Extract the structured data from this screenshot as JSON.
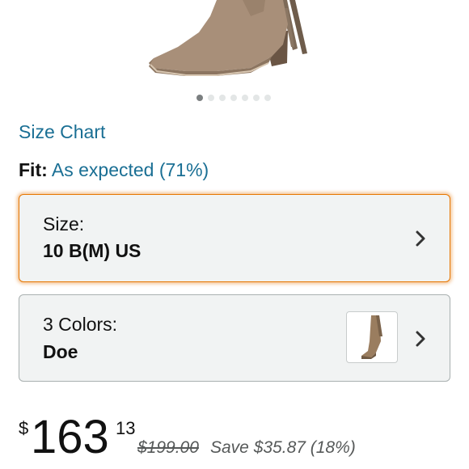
{
  "carousel": {
    "count": 7,
    "active_index": 0
  },
  "size_chart": {
    "label": "Size Chart"
  },
  "fit": {
    "label": "Fit:",
    "value": "As expected (71%)"
  },
  "size_selector": {
    "label": "Size:",
    "value": "10 B(M) US",
    "icon": "chevron-right-icon"
  },
  "color_selector": {
    "label": "3 Colors:",
    "value": "Doe",
    "icon": "chevron-right-icon"
  },
  "price": {
    "symbol": "$",
    "whole": "163",
    "fraction": "13",
    "list_price": "$199.00",
    "savings": "Save $35.87 (18%)"
  },
  "colors": {
    "link": "#1a6f94",
    "focus_outline": "#e77600"
  }
}
